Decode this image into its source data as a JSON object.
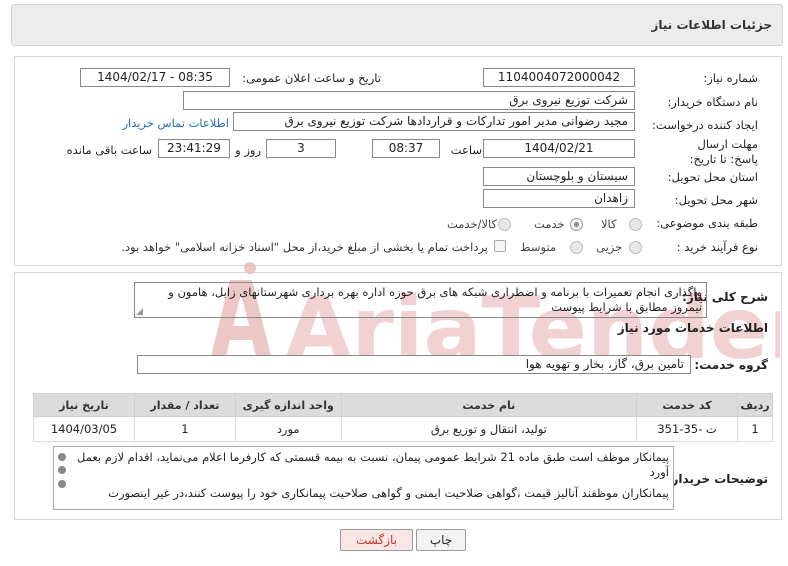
{
  "header": {
    "title": "جزئیات اطلاعات نیاز"
  },
  "form": {
    "need_number_label": "شماره نیاز:",
    "need_number": "1104004072000042",
    "announce_label": "تاریخ و ساعت اعلان عمومی:",
    "announce_value": "1404/02/17 - 08:35",
    "buyer_org_label": "نام دستگاه خریدار:",
    "buyer_org": "شرکت توزیع نیروی برق",
    "requester_label": "ایجاد کننده درخواست:",
    "requester": "مجید  رضوانی مدیر امور تدارکات و قراردادها شرکت توزیع نیروی برق",
    "contact_link": "اطلاعات تماس خریدار",
    "deadline_label": "مهلت ارسال پاسخ: تا تاریخ:",
    "deadline_date": "1404/02/21",
    "time_label": "ساعت",
    "deadline_time": "08:37",
    "days_value": "3",
    "days_label": "روز و",
    "remaining_time": "23:41:29",
    "remaining_label": "ساعت باقی مانده",
    "province_label": "استان محل تحویل:",
    "province": "سیستان و بلوچستان",
    "city_label": "شهر محل تحویل:",
    "city": "زاهدان",
    "category_label": "طبقه بندی موضوعی:",
    "category_options": [
      "کالا",
      "خدمت",
      "کالا/خدمت"
    ],
    "category_selected": "خدمت",
    "process_label": "نوع فرآیند خرید :",
    "process_options": [
      "جزیی",
      "متوسط"
    ],
    "process_selected": "جزیی",
    "payment_note": "پرداخت تمام یا بخشی از مبلغ خرید،از محل \"اسناد خزانه اسلامی\" خواهد بود."
  },
  "summary": {
    "label": "شرح کلی نیاز:",
    "text": "واگذاری انجام تعمیرات با برنامه و اضطراری شبکه های برق حوزه اداره بهره برداری شهرستانهای زابل، هامون و نیمروز مطابق با شرایط پیوست"
  },
  "services": {
    "section_title": "اطلاعات خدمات مورد نیاز",
    "group_label": "گروه خدمت:",
    "group_value": "تامین برق، گاز، بخار و تهویه هوا",
    "columns": [
      "ردیف",
      "کد خدمت",
      "نام خدمت",
      "واحد اندازه گیری",
      "تعداد / مقدار",
      "تاریخ نیاز"
    ],
    "rows": [
      [
        "1",
        "ت -35-351",
        "تولید، انتقال و توزیع برق",
        "مورد",
        "1",
        "1404/03/05"
      ]
    ]
  },
  "notes": {
    "label": "توضیحات خریدار:",
    "line1": "پیمانکار موظف است طبق ماده 21 شرایط عمومی پیمان، نسبت به بیمه قسمتی که کارفرما اعلام می‌نماید، اقدام لازم بعمل آورد",
    "line2": "پیمانکاران موظفند آنالیز قیمت ،گواهی صلاحیت ایمنی و گواهی صلاحیت پیمانکاری خود را پیوست کنند،در غیر اینصورت"
  },
  "buttons": {
    "print": "چاپ",
    "back": "بازگشت"
  },
  "watermark": {
    "text": "AriaTender.neT"
  },
  "colors": {
    "link": "#1d6fb8",
    "back_text": "#c0392b",
    "back_bg": "#fbe6e6",
    "header_bg": "#ececec",
    "table_header": "#dcdcdc",
    "watermark": "#e8b3b3"
  }
}
